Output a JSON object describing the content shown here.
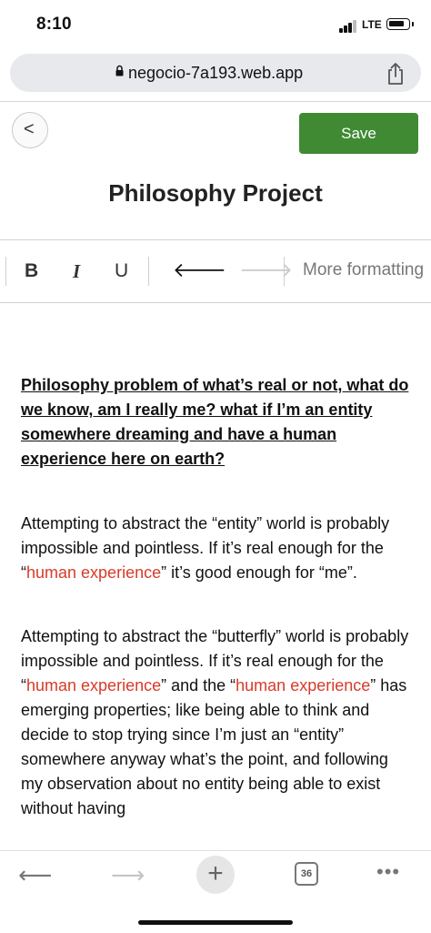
{
  "status_bar": {
    "time": "8:10",
    "network": "LTE"
  },
  "browser": {
    "url": "negocio-7a193.web.app",
    "tab_count": "36"
  },
  "header": {
    "back_label": "<",
    "save_label": "Save",
    "title": "Philosophy Project"
  },
  "toolbar": {
    "bold": "B",
    "italic": "I",
    "underline": "U",
    "undo": "🡐",
    "redo": "🡒",
    "more": "More formatting"
  },
  "document": {
    "heading": "Philosophy problem of what’s real or not, what do we know, am I really me? what if I’m an entity somewhere dreaming and have a human experience here on earth?",
    "para1": {
      "a": "Attempting to abstract the “entity” world is probably impossible and pointless. If it’s real enough for the “",
      "hl": "human experience",
      "b": "” it’s good enough for “me”."
    },
    "para2": {
      "a": "Attempting to abstract the “butterfly” world is probably impossible and pointless. If it’s real enough for the “",
      "hl1": "human experience",
      "b": "” and the “",
      "hl2": "human experience",
      "c": "” has emerging properties; like being able to think and decide to stop trying since I’m just an “entity” somewhere anyway what’s the point, and following my observation about no entity being able to exist without having"
    }
  },
  "colors": {
    "save_button": "#3f8a33",
    "highlight": "#d83b2a"
  }
}
